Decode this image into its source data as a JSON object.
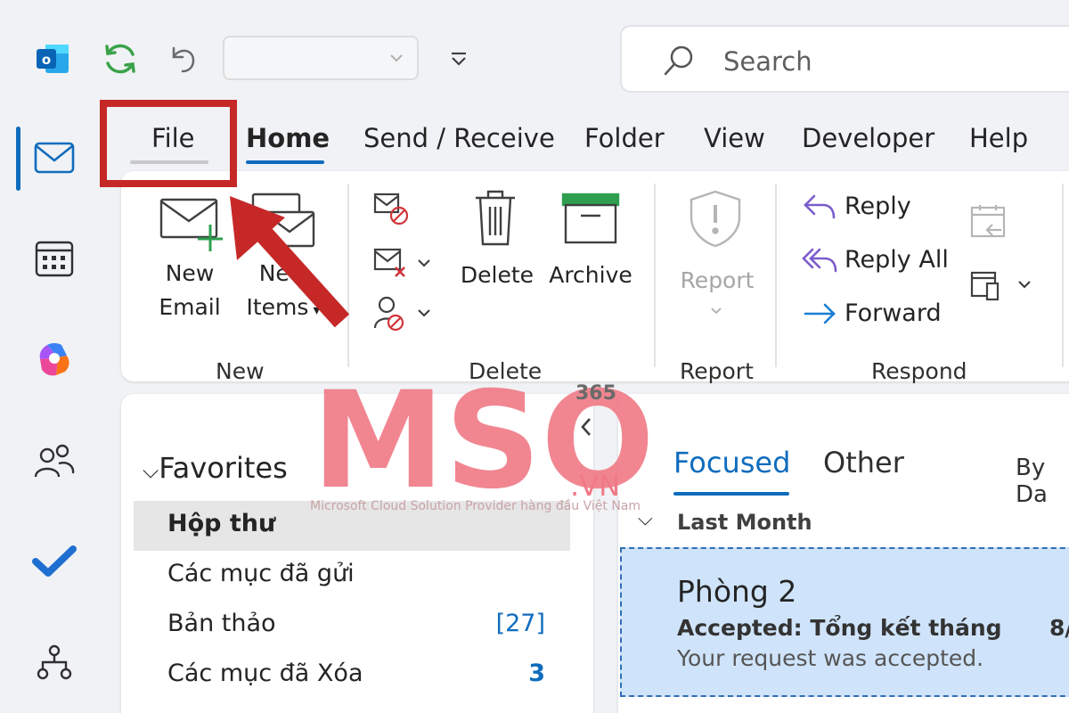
{
  "colors": {
    "accent": "#0f6cbd",
    "highlight": "#c62828",
    "selected_message": "#cfe4fa",
    "selected_folder": "#e6e6e6",
    "watermark": "#f07a86"
  },
  "search": {
    "placeholder": "Search"
  },
  "quick_access": {
    "icons": [
      "outlook-logo-icon",
      "refresh-icon",
      "undo-icon",
      "combo-chevron-icon",
      "customize-icon"
    ]
  },
  "rail": {
    "icons": [
      "mail-icon",
      "calendar-icon",
      "copilot-icon",
      "people-icon",
      "todo-check-icon",
      "org-icon"
    ],
    "active": "mail-icon"
  },
  "tabs": [
    {
      "label": "File"
    },
    {
      "label": "Home"
    },
    {
      "label": "Send / Receive"
    },
    {
      "label": "Folder"
    },
    {
      "label": "View"
    },
    {
      "label": "Developer"
    },
    {
      "label": "Help"
    }
  ],
  "ribbon": {
    "new_group": {
      "label": "New",
      "new_email": "New\nEmail",
      "new_items_line1": "New",
      "new_items_line2": "Items"
    },
    "delete_group": {
      "label": "Delete",
      "delete": "Delete",
      "archive": "Archive"
    },
    "report_group": {
      "label": "Report",
      "report": "Report"
    },
    "respond_group": {
      "label": "Respond",
      "reply": "Reply",
      "reply_all": "Reply All",
      "forward": "Forward"
    }
  },
  "folder_pane": {
    "favorites": "Favorites",
    "items": [
      {
        "name": "Hộp thư",
        "count": "",
        "selected": true
      },
      {
        "name": "Các mục đã gửi",
        "count": ""
      },
      {
        "name": "Bản thảo",
        "count": "[27]"
      },
      {
        "name": "Các mục đã Xóa",
        "count": "3"
      }
    ]
  },
  "message_list": {
    "tabs": [
      "Focused",
      "Other"
    ],
    "sort": "By Da",
    "group": "Last Month",
    "items": [
      {
        "from": "Phòng 2",
        "subject": "Accepted: Tổng kết tháng",
        "preview": "Your request was accepted.",
        "date": "8/"
      }
    ]
  },
  "watermark": {
    "logo": "MSO",
    "superscript": "365",
    "domain": ".VN",
    "tagline": "Microsoft Cloud Solution Provider hàng đầu Việt Nam"
  }
}
